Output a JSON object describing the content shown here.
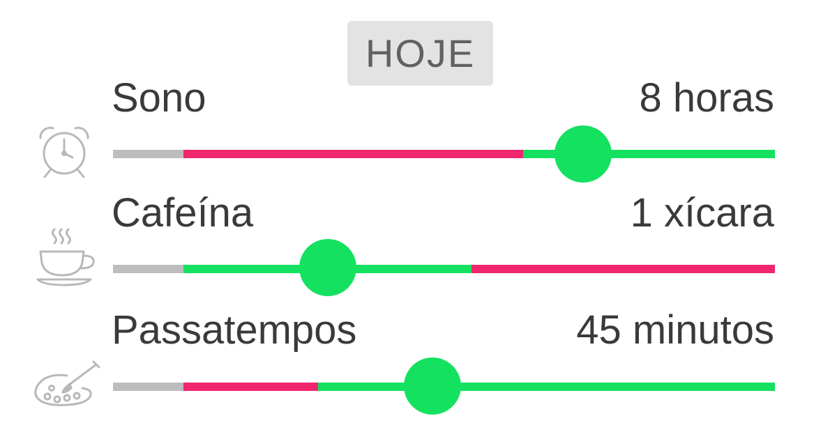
{
  "header": {
    "day_label": "HOJE"
  },
  "colors": {
    "neutral": "#bdbdbd",
    "bad": "#f0266f",
    "good": "#15e160",
    "badge_background": "#e3e3e3",
    "text": "#3a3a3a"
  },
  "trackers": [
    {
      "label": "Sono",
      "value_text": "8 horas",
      "icon": "alarm-clock-icon",
      "slider_level": 0.71,
      "zones": [
        {
          "from": 0.0,
          "to": 0.106,
          "kind": "neutral"
        },
        {
          "from": 0.106,
          "to": 0.62,
          "kind": "bad"
        },
        {
          "from": 0.62,
          "to": 1.0,
          "kind": "good"
        }
      ]
    },
    {
      "label": "Cafeína",
      "value_text": "1 xícara",
      "icon": "coffee-cup-icon",
      "slider_level": 0.325,
      "zones": [
        {
          "from": 0.0,
          "to": 0.106,
          "kind": "neutral"
        },
        {
          "from": 0.106,
          "to": 0.542,
          "kind": "good"
        },
        {
          "from": 0.542,
          "to": 1.0,
          "kind": "bad"
        }
      ]
    },
    {
      "label": "Passatempos",
      "value_text": "45 minutos",
      "icon": "paint-palette-icon",
      "slider_level": 0.483,
      "zones": [
        {
          "from": 0.0,
          "to": 0.106,
          "kind": "neutral"
        },
        {
          "from": 0.106,
          "to": 0.31,
          "kind": "bad"
        },
        {
          "from": 0.31,
          "to": 1.0,
          "kind": "good"
        }
      ]
    }
  ]
}
